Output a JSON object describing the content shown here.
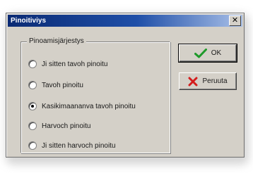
{
  "dialog": {
    "title": "Pinoitiviys",
    "close_glyph": "✕",
    "group_label": "Pinoamisjärjestys",
    "options": [
      {
        "label": "Ji sitten tavoh pinoitu"
      },
      {
        "label": "Tavoh pinoitu"
      },
      {
        "label": "Kasikimaananva tavoh pinoitu"
      },
      {
        "label": "Harvoch pinoitu"
      },
      {
        "label": "Ji sitten harvoch pinoitu"
      }
    ],
    "selected_option_index": 2,
    "ok_button": {
      "label": "OK",
      "icon": "checkmark-icon"
    },
    "cancel_button": {
      "label": "Peruuta",
      "icon": "x-mark-icon"
    }
  },
  "colors": {
    "title_gradient_start": "#0a2a74",
    "title_gradient_end": "#a9c0e8",
    "dialog_face": "#d4d0c8",
    "ok_icon": "#1e9a2a",
    "cancel_icon": "#d41c1c"
  }
}
